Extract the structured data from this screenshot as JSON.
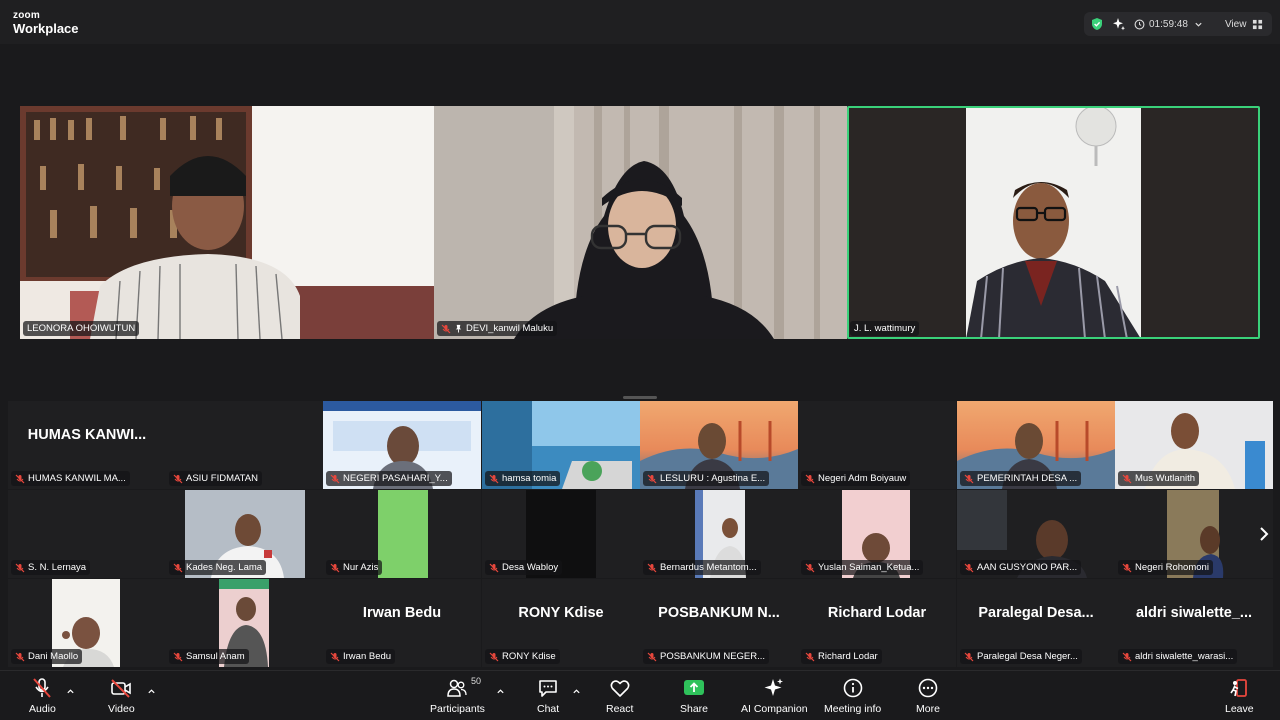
{
  "app": {
    "brand_top": "zoom",
    "brand_bottom": "Workplace"
  },
  "status_bar": {
    "timer": "01:59:48",
    "view_label": "View",
    "shield_color": "#3ad17a"
  },
  "speakers": [
    {
      "name": "LEONORA OHOIWUTUN",
      "muted": false,
      "pinned": false
    },
    {
      "name": "DEVI_kanwil Maluku",
      "muted": true,
      "pinned": true
    },
    {
      "name": "J. L. wattimury",
      "muted": false,
      "pinned": false,
      "active": true
    }
  ],
  "gallery": [
    {
      "name": "HUMAS KANWIL MA...",
      "big": "HUMAS  KANWI..."
    },
    {
      "name": "ASIU FIDMATAN"
    },
    {
      "name": "NEGERI PASAHARI_Y..."
    },
    {
      "name": "hamsa tomia"
    },
    {
      "name": "LESLURU : Agustina E..."
    },
    {
      "name": "Negeri Adm Boiyauw"
    },
    {
      "name": "PEMERINTAH DESA ..."
    },
    {
      "name": "Mus Wutlanith"
    },
    {
      "name": "S. N. Lernaya"
    },
    {
      "name": "Kades Neg. Lama"
    },
    {
      "name": "Nur Azis"
    },
    {
      "name": "Desa Wabloy"
    },
    {
      "name": "Bernardus Metantom..."
    },
    {
      "name": "Yuslan Saiman_Ketua..."
    },
    {
      "name": "AAN GUSYONO PAR..."
    },
    {
      "name": "Negeri Rohomoni"
    },
    {
      "name": "Dani Maollo"
    },
    {
      "name": "Samsul Anam"
    },
    {
      "name": "Irwan Bedu",
      "big": "Irwan Bedu"
    },
    {
      "name": "RONY Kdise",
      "big": "RONY Kdise"
    },
    {
      "name": "POSBANKUM NEGER...",
      "big": "POSBANKUM  N..."
    },
    {
      "name": "Richard Lodar",
      "big": "Richard Lodar"
    },
    {
      "name": "Paralegal Desa Neger...",
      "big": "Paralegal  Desa..."
    },
    {
      "name": "aldri siwalette_warasi...",
      "big": "aldri  siwalette_..."
    }
  ],
  "toolbar": {
    "audio": "Audio",
    "video": "Video",
    "participants": "Participants",
    "participants_count": "50",
    "chat": "Chat",
    "react": "React",
    "share": "Share",
    "ai_companion": "AI Companion",
    "meeting_info": "Meeting info",
    "more": "More",
    "leave": "Leave",
    "share_color": "#2fc25b",
    "leave_color": "#e8473d",
    "mute_color": "#e8473d"
  }
}
